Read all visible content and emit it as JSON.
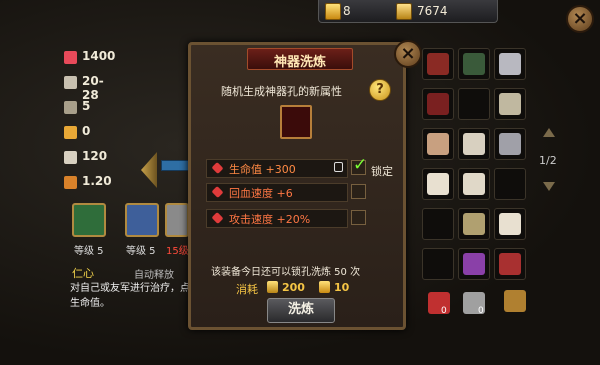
{
  "currency": {
    "gold": "8",
    "gems": "7674"
  },
  "stats": [
    {
      "icon": "heart-icon",
      "value": "1400",
      "color": "#e84a5a"
    },
    {
      "icon": "swords-icon",
      "value": "20-28",
      "color": "#c8c0b0"
    },
    {
      "icon": "armor-icon",
      "value": "5",
      "color": "#a89f8a"
    },
    {
      "icon": "shield-icon",
      "value": "0",
      "color": "#e8a836"
    },
    {
      "icon": "horse-icon",
      "value": "120",
      "color": "#d8d0c0"
    },
    {
      "icon": "boot-icon",
      "value": "1.20",
      "color": "#d9822a"
    }
  ],
  "skills": [
    {
      "level": "等级 5",
      "color": "#2f6d3a"
    },
    {
      "level": "等级 5",
      "color": "#3e5f9a"
    },
    {
      "level": "15级",
      "color": "#8a8a8a"
    }
  ],
  "skill_info": {
    "name": "仁心",
    "mode": "自动释放",
    "description": "对自己或友军进行治疗，点生命值。"
  },
  "modal": {
    "title": "神器洗炼",
    "subtitle": "随机生成神器孔的新属性",
    "help": "?",
    "attributes": [
      {
        "text": "生命值 +300",
        "locked": true
      },
      {
        "text": "回血速度 +6",
        "locked": false
      },
      {
        "text": "攻击速度 +20%",
        "locked": false
      }
    ],
    "lock_label": "锁定",
    "notice": "该装备今日还可以锁孔洗炼 50 次",
    "cost_label": "消耗",
    "cost_gold": "200",
    "cost_gems": "10",
    "refine_button": "洗炼"
  },
  "inventory": {
    "page": "1/2",
    "items": [
      {
        "icon": "armor-red-icon",
        "color": "#8a2a24"
      },
      {
        "icon": "cloak-icon",
        "color": "#3a5a3a"
      },
      {
        "icon": "blade-icon",
        "color": "#b8b8c0"
      },
      {
        "icon": "armor-red-icon",
        "color": "#7a2020"
      },
      {
        "icon": "empty",
        "color": ""
      },
      {
        "icon": "necklace-icon",
        "color": "#c0b8a0"
      },
      {
        "icon": "horse-icon",
        "color": "#c8a080"
      },
      {
        "icon": "necklace-icon",
        "color": "#d8d0c0"
      },
      {
        "icon": "spear-icon",
        "color": "#a0a0a8"
      },
      {
        "icon": "horse-icon",
        "color": "#e8e0d0"
      },
      {
        "icon": "horse-icon",
        "color": "#e0d8c8"
      },
      {
        "icon": "empty",
        "color": ""
      },
      {
        "icon": "empty",
        "color": ""
      },
      {
        "icon": "arrows-icon",
        "color": "#b0a070"
      },
      {
        "icon": "horse-icon",
        "color": "#e8e0d0"
      },
      {
        "icon": "empty",
        "color": ""
      },
      {
        "icon": "pouch-icon",
        "color": "#8a40a8"
      },
      {
        "icon": "sword-icon",
        "color": "#a83030"
      }
    ],
    "bottom_items": [
      {
        "icon": "gem-red-icon",
        "color": "#c03030",
        "count": "0"
      },
      {
        "icon": "stone-icon",
        "color": "#a0a0a0",
        "count": "0"
      },
      {
        "icon": "chest-icon",
        "color": "#b08030",
        "count": ""
      }
    ]
  }
}
